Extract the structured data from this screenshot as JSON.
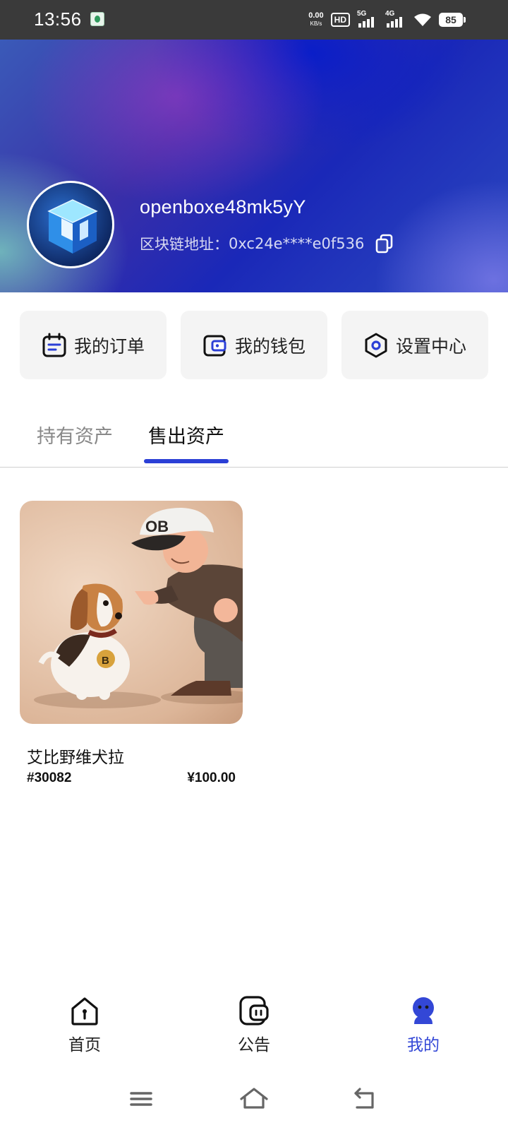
{
  "status_bar": {
    "time": "13:56",
    "net_speed": "0.00",
    "net_unit": "KB/s",
    "hd": "HD",
    "signal1": "5G",
    "signal2": "4G",
    "battery": "85"
  },
  "profile": {
    "username": "openboxe48mk5yY",
    "address_label": "区块链地址：",
    "address": "0xc24e****e0f536"
  },
  "actions": [
    {
      "label": "我的订单",
      "icon": "order-icon"
    },
    {
      "label": "我的钱包",
      "icon": "wallet-icon"
    },
    {
      "label": "设置中心",
      "icon": "settings-icon"
    }
  ],
  "tabs": [
    {
      "label": "持有资产",
      "active": false
    },
    {
      "label": "售出资产",
      "active": true
    }
  ],
  "assets": [
    {
      "name": "艾比野维犬拉",
      "id": "#30082",
      "price": "¥100.00",
      "cap_text": "OB",
      "tag_text": "B"
    }
  ],
  "bottom_nav": [
    {
      "label": "首页",
      "icon": "home-icon",
      "active": false
    },
    {
      "label": "公告",
      "icon": "notice-icon",
      "active": false
    },
    {
      "label": "我的",
      "icon": "profile-icon",
      "active": true
    }
  ],
  "colors": {
    "accent": "#2b3fd6",
    "active_nav": "#3347d6",
    "card_bg": "#f4f4f4"
  }
}
